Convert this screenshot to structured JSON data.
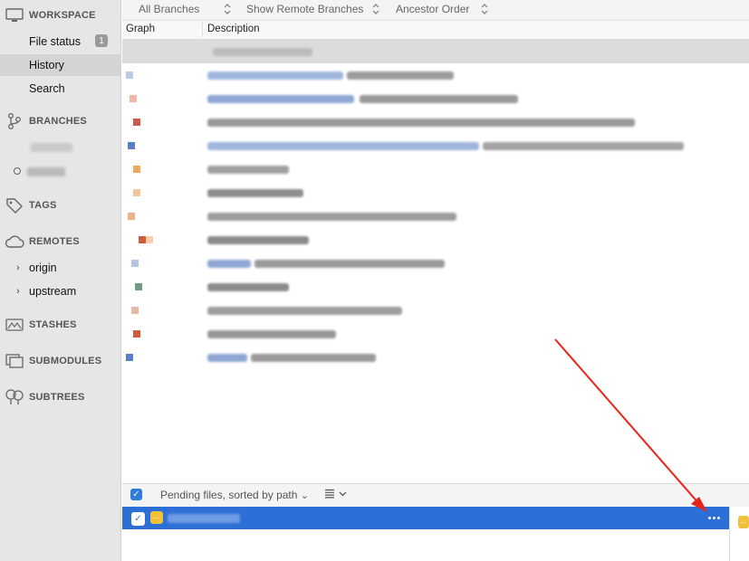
{
  "sidebar": {
    "workspace": {
      "title": "WORKSPACE",
      "file_status": "File status",
      "file_status_count": "1",
      "history": "History",
      "search": "Search"
    },
    "branches": {
      "title": "BRANCHES"
    },
    "tags": {
      "title": "TAGS"
    },
    "remotes": {
      "title": "REMOTES",
      "items": [
        "origin",
        "upstream"
      ]
    },
    "stashes": {
      "title": "STASHES"
    },
    "submodules": {
      "title": "SUBMODULES"
    },
    "subtrees": {
      "title": "SUBTREES"
    }
  },
  "toolbar": {
    "branches": "All Branches",
    "remote": "Show Remote Branches",
    "order": "Ancestor Order"
  },
  "columns": {
    "graph": "Graph",
    "description": "Description"
  },
  "pending": {
    "label": "Pending files, sorted by path",
    "chevron": "⌄"
  },
  "colors": {
    "accent": "#2c6fd6",
    "annotation_arrow": "#e8231a",
    "file_icon": "#f2c13b"
  }
}
